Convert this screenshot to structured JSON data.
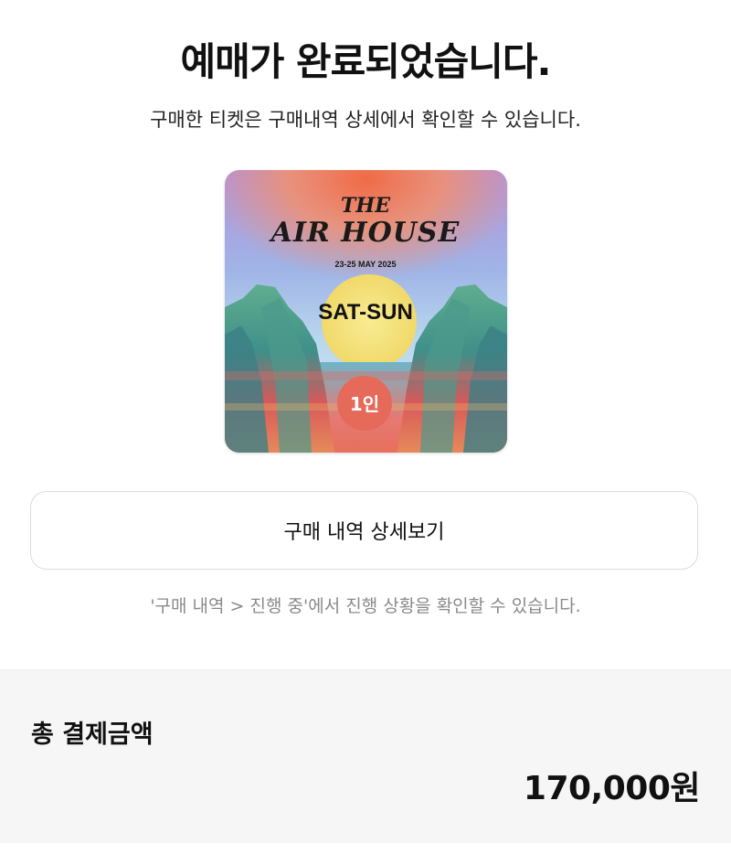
{
  "header": {
    "title": "예매가 완료되었습니다.",
    "subtitle": "구매한 티켓은 구매내역 상세에서 확인할 수 있습니다."
  },
  "ticket": {
    "event_name_line1": "THE",
    "event_name_line2": "AIR HOUSE",
    "dates": "23-25 MAY 2025",
    "pass_type": "SAT-SUN",
    "quantity_badge": "1인"
  },
  "actions": {
    "detail_button": "구매 내역 상세보기"
  },
  "note": "'구매 내역 > 진행 중'에서 진행 상황을 확인할 수 있습니다.",
  "payment": {
    "label": "총 결제금액",
    "amount": "170,000원"
  },
  "colors": {
    "badge": "#e56a59",
    "sun": "#f4e27a",
    "sky_top": "#8ea0e6",
    "sky_glow": "#f07a52"
  }
}
